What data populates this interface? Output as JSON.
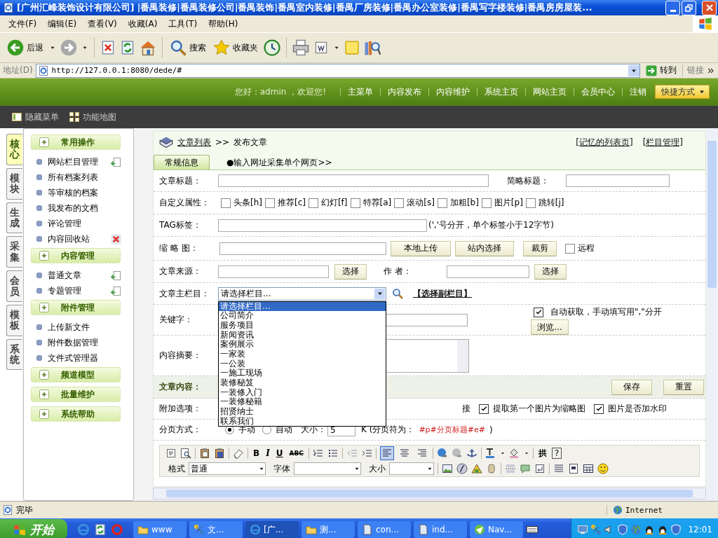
{
  "window": {
    "title": "[广州汇峰装饰设计有限公司] |番禺装修|番禺装修公司|番禺装饰|番禺室内装修|番禺厂房装修|番禺办公室装修|番禺写字楼装修|番禺房房屋装..."
  },
  "menu_bar": [
    "文件(F)",
    "编辑(E)",
    "查看(V)",
    "收藏(A)",
    "工具(T)",
    "帮助(H)"
  ],
  "toolbar": {
    "back": "后退",
    "search": "搜索",
    "favorites": "收藏夹"
  },
  "address_bar": {
    "label": "地址(D)",
    "url": "http://127.0.0.1:8080/dede/#",
    "go": "转到",
    "links": "链接"
  },
  "header": {
    "greeting": "您好：admin ，欢迎您!",
    "nav": [
      "主菜单",
      "内容发布",
      "内容维护",
      "系统主页",
      "网站主页",
      "会员中心",
      "注销"
    ],
    "quick": "快捷方式"
  },
  "subbar": [
    "隐藏菜单",
    "功能地图"
  ],
  "side_tabs": [
    {
      "label": "核心",
      "selected": true
    },
    {
      "label": "模块",
      "selected": false
    },
    {
      "label": "生成",
      "selected": false
    },
    {
      "label": "采集",
      "selected": false
    },
    {
      "label": "会员",
      "selected": false
    },
    {
      "label": "模板",
      "selected": false
    },
    {
      "label": "系统",
      "selected": false
    }
  ],
  "menu_groups": [
    {
      "title": "常用操作",
      "items": [
        {
          "label": "网站栏目管理",
          "kind": "add"
        },
        {
          "label": "所有档案列表"
        },
        {
          "label": "等审核的档案"
        },
        {
          "label": "我发布的文档"
        },
        {
          "label": "评论管理"
        },
        {
          "label": "内容回收站",
          "kind": "delete"
        }
      ]
    },
    {
      "title": "内容管理",
      "items": [
        {
          "label": "普通文章",
          "kind": "add"
        },
        {
          "label": "专题管理",
          "kind": "add"
        }
      ]
    },
    {
      "title": "附件管理",
      "items": [
        {
          "label": "上传新文件"
        },
        {
          "label": "附件数据管理"
        },
        {
          "label": "文件式管理器"
        }
      ]
    },
    {
      "title": "频道模型"
    },
    {
      "title": "批量维护"
    },
    {
      "title": "系统帮助"
    }
  ],
  "breadcrumb": {
    "link": "文章列表",
    "separator": ">>",
    "current": "发布文章",
    "right_links": [
      "[记忆的列表页]",
      "[栏目管理]"
    ]
  },
  "tabs": [
    {
      "label": "常规信息",
      "selected": true
    },
    {
      "label": "●输入网址采集单个网页>>",
      "selected": false
    }
  ],
  "form": {
    "title_label": "文章标题：",
    "short_title_label": "简略标题：",
    "attributes_label": "自定义属性：",
    "attributes": [
      {
        "label": "头条[h]",
        "checked": false
      },
      {
        "label": "推荐[c]",
        "checked": false
      },
      {
        "label": "幻灯[f]",
        "checked": false
      },
      {
        "label": "特荐[a]",
        "checked": false
      },
      {
        "label": "滚动[s]",
        "checked": false
      },
      {
        "label": "加粗[b]",
        "checked": false
      },
      {
        "label": "图片[p]",
        "checked": false
      },
      {
        "label": "跳转[j]",
        "checked": false
      }
    ],
    "tag_label": "TAG标签：",
    "tag_hint": "(','号分开，单个标签小于12字节)",
    "thumb_label": "缩 略 图：",
    "thumb_buttons": [
      "本地上传",
      "站内选择",
      "裁剪"
    ],
    "remote": {
      "label": "远程",
      "checked": false
    },
    "source_label": "文章来源：",
    "source_button": "选择",
    "author_label": "作 者：",
    "author_button": "选择",
    "category_label": "文章主栏目：",
    "category_value": "请选择栏目...",
    "sub_category_link": "【选择副栏目】",
    "category_options": [
      {
        "label": "请选择栏目...",
        "selected": true
      },
      {
        "label": "公司简介",
        "selected": false
      },
      {
        "label": "服务项目",
        "selected": false
      },
      {
        "label": "新闻资讯",
        "selected": false
      },
      {
        "label": "案例展示",
        "selected": false
      },
      {
        "label": "一家装",
        "selected": false
      },
      {
        "label": "一公装",
        "selected": false
      },
      {
        "label": "一施工现场",
        "selected": false
      },
      {
        "label": "装修秘笈",
        "selected": false
      },
      {
        "label": "一装修入门",
        "selected": false
      },
      {
        "label": "一装修秘籍",
        "selected": false
      },
      {
        "label": "招贤纳士",
        "selected": false
      },
      {
        "label": "联系我们",
        "selected": false
      }
    ],
    "keywords_label": "关键字：",
    "auto_keywords": {
      "label": "自动获取，手动填写用\",\"分开",
      "checked": true
    },
    "browse_button": "浏览...",
    "summary_label": "内容摘要：",
    "content_label": "文章内容：",
    "save_button": "保存",
    "reset_button": "重置",
    "extra_label": "附加选项：",
    "extra_fragment": "接",
    "extra_options": [
      {
        "label": "提取第一个图片为缩略图",
        "checked": true
      },
      {
        "label": "图片是否加水印",
        "checked": true
      }
    ],
    "paging_label": "分页方式：",
    "paging_modes": [
      {
        "label": "手动",
        "selected": true
      },
      {
        "label": "自动",
        "selected": false
      }
    ],
    "size_label": "大小：",
    "size_value": "5",
    "separator_note": "K (分页符为：",
    "separator_code": "#p#分页标题#e#",
    "separator_end": ")"
  },
  "editor": {
    "text_buttons": [
      "B",
      "I",
      "U",
      "ABC",
      "拱",
      "?"
    ],
    "align_buttons": [
      {
        "selected": true
      },
      {
        "selected": false
      },
      {
        "selected": false
      }
    ],
    "format_label": "格式",
    "format_value": "普通",
    "font_label": "字体",
    "size_label": "大小"
  },
  "status_bar": {
    "text": "完毕",
    "zone": "Internet"
  },
  "taskbar": {
    "start": "开始",
    "tasks": [
      {
        "label": "www",
        "kind": "folder",
        "selected": false
      },
      {
        "label": "文...",
        "kind": "network",
        "selected": false
      },
      {
        "label": "[广...",
        "kind": "browser",
        "selected": true
      },
      {
        "label": "测...",
        "kind": "folder",
        "selected": false
      },
      {
        "label": "con...",
        "kind": "file",
        "selected": false
      },
      {
        "label": "ind...",
        "kind": "file",
        "selected": false
      },
      {
        "label": "Nav...",
        "kind": "app",
        "selected": false
      }
    ],
    "clock": "12:01"
  }
}
